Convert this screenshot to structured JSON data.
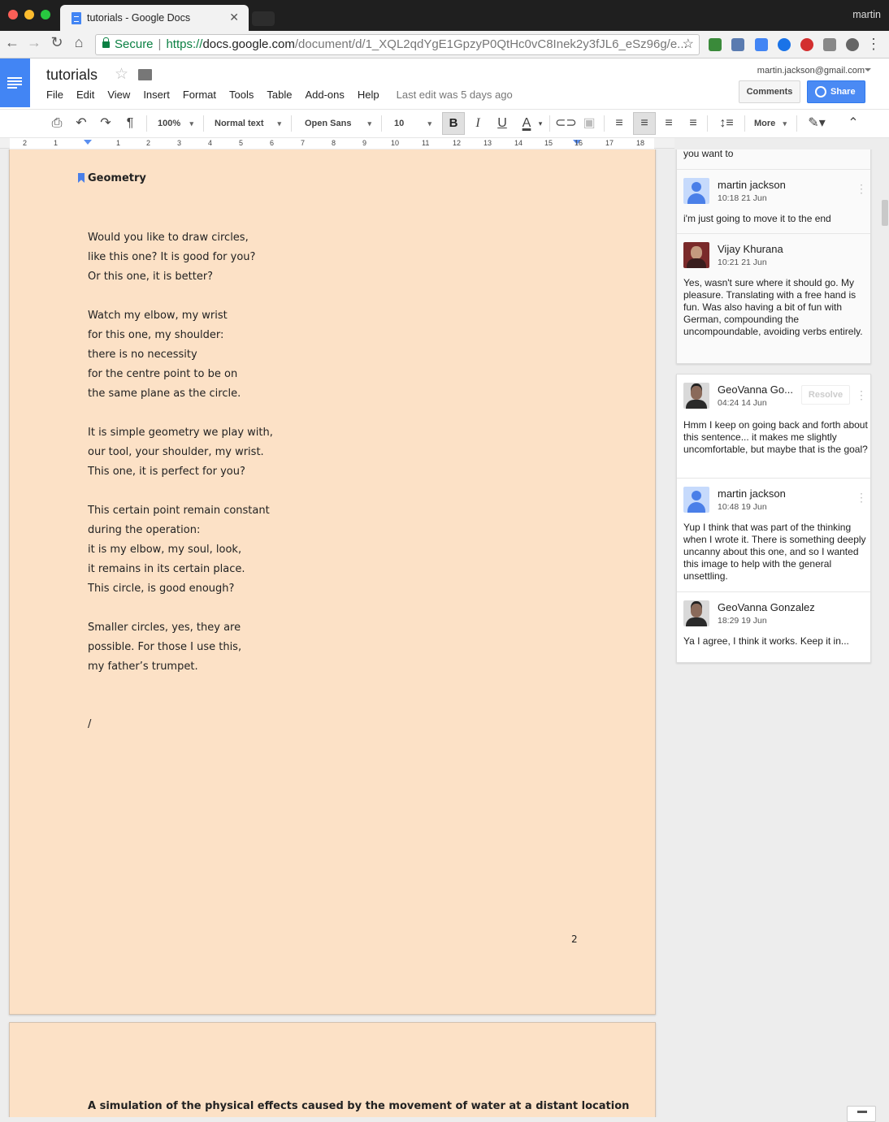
{
  "browser": {
    "tab_title": "tutorials - Google Docs",
    "user": "martin",
    "secure_label": "Secure",
    "url_scheme": "https://",
    "url_host": "docs.google.com",
    "url_path": "/document/d/1_XQL2qdYgE1GpzyP0QtHc0vC8Inek2y3fJL6_eSz96g/e..."
  },
  "docs": {
    "title": "tutorials",
    "menu": [
      "File",
      "Edit",
      "View",
      "Insert",
      "Format",
      "Tools",
      "Table",
      "Add-ons",
      "Help"
    ],
    "last_edit": "Last edit was 5 days ago",
    "account_email": "martin.jackson@gmail.com",
    "comments_label": "Comments",
    "share_label": "Share"
  },
  "toolbar": {
    "zoom": "100%",
    "style": "Normal text",
    "font": "Open Sans",
    "size": "10",
    "bold": "B",
    "italic": "I",
    "underline": "U",
    "text_color": "A",
    "more": "More"
  },
  "ruler": [
    "2",
    "1",
    "1",
    "2",
    "3",
    "4",
    "5",
    "6",
    "7",
    "8",
    "9",
    "10",
    "11",
    "12",
    "13",
    "14",
    "15",
    "16",
    "17",
    "18"
  ],
  "page1": {
    "heading": "Geometry",
    "lines": [
      "Would you like to draw circles,",
      "like this one? It is good for you?",
      "Or this one, it is better?",
      "",
      "Watch my elbow, my wrist",
      "for this one, my shoulder:",
      "there is no necessity",
      "for the centre point to be on",
      "the same plane as the circle.",
      "",
      "It is simple geometry we play with,",
      "our tool, your shoulder, my wrist.",
      "This one, it is perfect for you?",
      "",
      "This certain point remain constant",
      "during the operation:",
      "it is my elbow, my soul, look,",
      "it remains in its certain place.",
      "This circle, is good enough?",
      "",
      "Smaller circles, yes, they are",
      "possible. For those I use this,",
      "my father’s trumpet."
    ],
    "slash": "/",
    "page_number": "2"
  },
  "page2": {
    "heading": "A simulation of the physical effects caused by the movement of water at a distant location"
  },
  "comments": {
    "thread1": {
      "partial_text": "you want to",
      "replies": [
        {
          "name": "martin jackson",
          "time": "10:18 21 Jun",
          "text": "i'm just going to move it to the end"
        },
        {
          "name": "Vijay Khurana",
          "time": "10:21 21 Jun",
          "text": "Yes, wasn't sure where it should go. My pleasure. Translating with a free hand is fun. Was also having a bit of fun with German, compounding the uncompoundable, avoiding verbs entirely."
        }
      ]
    },
    "thread2": {
      "resolve_label": "Resolve",
      "replies": [
        {
          "name": "GeoVanna Go...",
          "time": "04:24 14 Jun",
          "text": "Hmm I keep on going back and forth about this sentence... it makes me slightly uncomfortable, but maybe that is the goal?"
        },
        {
          "name": "martin jackson",
          "time": "10:48 19 Jun",
          "text": "Yup I think that was part of the thinking when I wrote it. There is something deeply uncanny about this one, and so I wanted this image to help with the general unsettling."
        },
        {
          "name": "GeoVanna Gonzalez",
          "time": "18:29 19 Jun",
          "text": "Ya I agree, I think it works. Keep it in..."
        }
      ]
    }
  }
}
